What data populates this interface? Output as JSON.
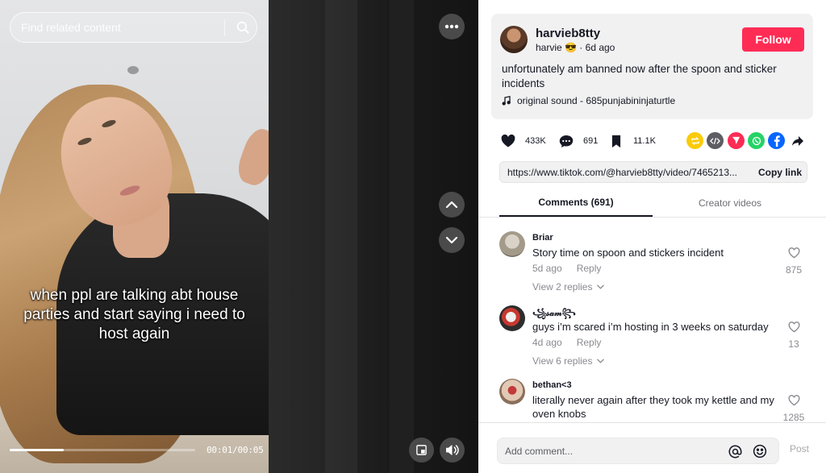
{
  "search": {
    "placeholder": "Find related content"
  },
  "video": {
    "caption": "when ppl are talking abt house parties and start saying i need to host again",
    "timestamp": "00:01/00:05",
    "progress": 0.29
  },
  "author": {
    "username": "harvieb8tty",
    "display_name": "harvie 😎",
    "separator": " · ",
    "posted": "6d ago",
    "follow_label": "Follow"
  },
  "post": {
    "description": "unfortunately am banned now after the spoon and sticker incidents",
    "music": "original sound - 685punjabininjaturtle"
  },
  "actions": {
    "likes": "433K",
    "comments": "691",
    "saves": "11.1K"
  },
  "share": {
    "icons": [
      "repost-icon",
      "embed-icon",
      "send-icon",
      "whatsapp-icon",
      "facebook-icon",
      "share-arrow-icon"
    ],
    "colors": {
      "repost": "#fbcb0b",
      "embed": "#5d5d63",
      "send": "#fe2c55",
      "whatsapp": "#25d366",
      "facebook": "#0866ff"
    }
  },
  "link": {
    "url": "https://www.tiktok.com/@harvieb8tty/video/7465213...",
    "copy_label": "Copy link"
  },
  "tabs": {
    "comments": "Comments (691)",
    "creator": "Creator videos"
  },
  "comments": [
    {
      "user": "Briar",
      "text": "Story time on spoon and stickers incident",
      "time": "5d ago",
      "reply": "Reply",
      "replies": "View 2 replies",
      "likes": "875"
    },
    {
      "user": "꧁𝓈𝒶𝓂꧂",
      "text": "guys i’m scared i’m hosting in 3 weeks on saturday",
      "time": "4d ago",
      "reply": "Reply",
      "replies": "View 6 replies",
      "likes": "13"
    },
    {
      "user": "bethan<3",
      "text": "literally never again after they took my kettle and my oven knobs",
      "likes": "1285"
    }
  ],
  "composer": {
    "placeholder": "Add comment...",
    "post_label": "Post"
  },
  "colors": {
    "accent": "#fe2c55",
    "text": "#161823",
    "muted": "#8a8b91"
  }
}
